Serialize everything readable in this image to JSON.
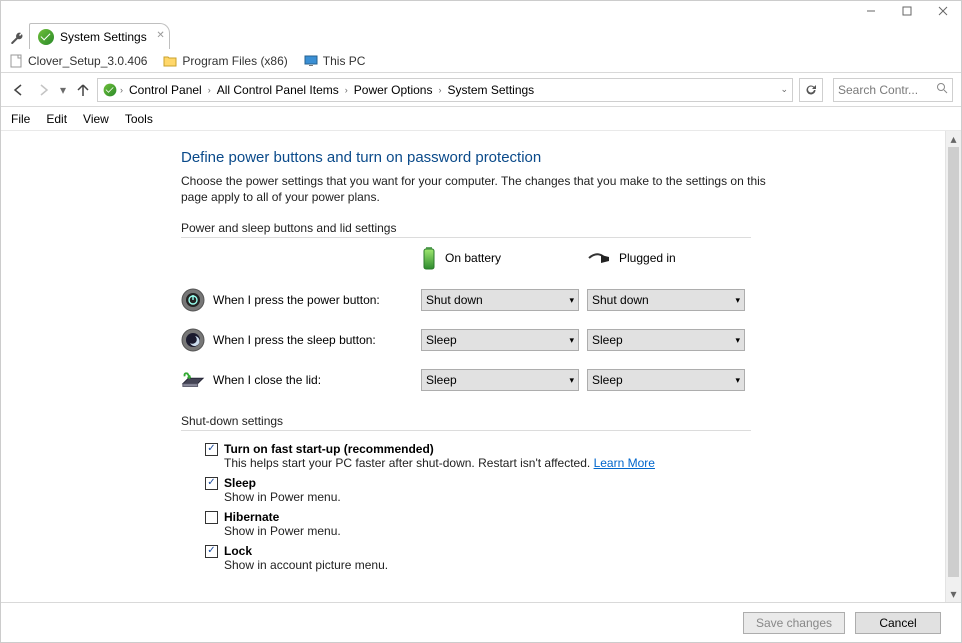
{
  "window": {
    "tab_title": "System Settings",
    "bookmarks": [
      {
        "label": "Clover_Setup_3.0.406",
        "icon": "file"
      },
      {
        "label": "Program Files (x86)",
        "icon": "folder"
      },
      {
        "label": "This PC",
        "icon": "pc"
      }
    ],
    "breadcrumbs": [
      "Control Panel",
      "All Control Panel Items",
      "Power Options",
      "System Settings"
    ],
    "search_placeholder": "Search Contr..."
  },
  "menu": [
    "File",
    "Edit",
    "View",
    "Tools"
  ],
  "page": {
    "title": "Define power buttons and turn on password protection",
    "description": "Choose the power settings that you want for your computer. The changes that you make to the settings on this page apply to all of your power plans.",
    "section1_head": "Power and sleep buttons and lid settings",
    "col_battery": "On battery",
    "col_plugged": "Plugged in",
    "rows": [
      {
        "label": "When I press the power button:",
        "battery": "Shut down",
        "plugged": "Shut down"
      },
      {
        "label": "When I press the sleep button:",
        "battery": "Sleep",
        "plugged": "Sleep"
      },
      {
        "label": "When I close the lid:",
        "battery": "Sleep",
        "plugged": "Sleep"
      }
    ],
    "section2_head": "Shut-down settings",
    "checks": [
      {
        "label": "Turn on fast start-up (recommended)",
        "sub": "This helps start your PC faster after shut-down. Restart isn't affected. ",
        "checked": true,
        "learn": "Learn More"
      },
      {
        "label": "Sleep",
        "sub": "Show in Power menu.",
        "checked": true
      },
      {
        "label": "Hibernate",
        "sub": "Show in Power menu.",
        "checked": false
      },
      {
        "label": "Lock",
        "sub": "Show in account picture menu.",
        "checked": true
      }
    ]
  },
  "footer": {
    "save": "Save changes",
    "cancel": "Cancel"
  }
}
